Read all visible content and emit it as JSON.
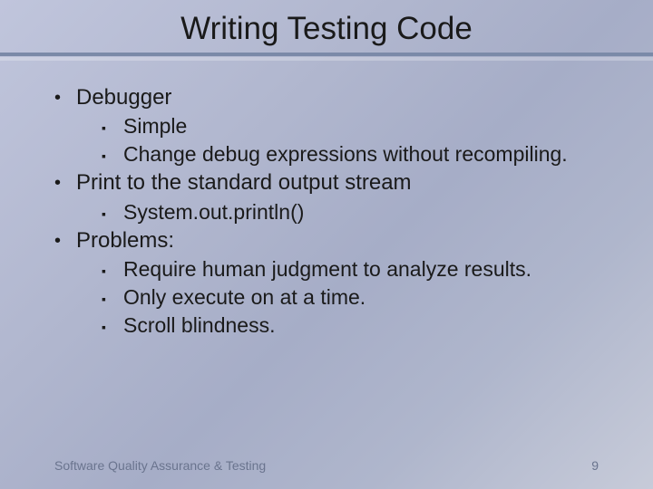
{
  "title": "Writing Testing Code",
  "bullets": {
    "i0": "Debugger",
    "i0_0": "Simple",
    "i0_1": "Change debug expressions without recompiling.",
    "i1": "Print to the standard output stream",
    "i1_0": "System.out.println()",
    "i2": "Problems:",
    "i2_0": "Require human judgment to analyze results.",
    "i2_1": "Only execute on at a time.",
    "i2_2": "Scroll blindness."
  },
  "footer": {
    "text": "Software Quality Assurance & Testing",
    "page": "9"
  }
}
